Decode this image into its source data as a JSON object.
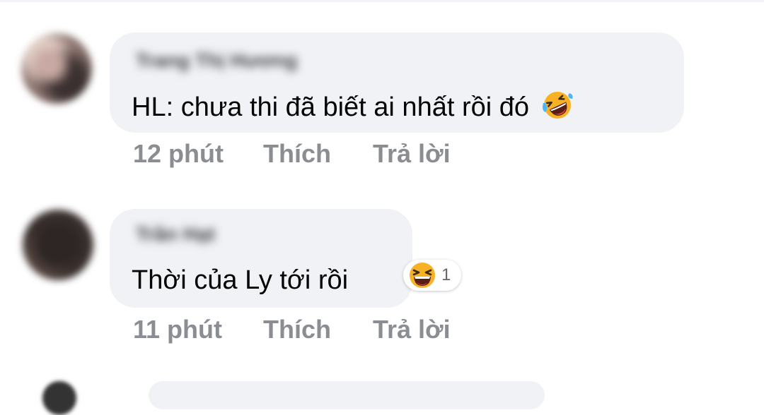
{
  "comments": [
    {
      "author": "Trang Thị Hương",
      "text": "HL: chưa thi đã biết ai nhất rồi đó",
      "inline_emoji": "rolling-on-floor-laughing-icon",
      "time": "12 phút",
      "like_label": "Thích",
      "reply_label": "Trả lời"
    },
    {
      "author": "Trần Hạt",
      "text": "Thời của Ly tới rồi",
      "reaction": {
        "icon": "haha-reaction-icon",
        "count": "1"
      },
      "time": "11 phút",
      "like_label": "Thích",
      "reply_label": "Trả lời"
    }
  ],
  "colors": {
    "bubble": "#f0f2f5",
    "text": "#050505",
    "meta": "#8a8d91",
    "emoji_yellow": "#f7b125"
  }
}
